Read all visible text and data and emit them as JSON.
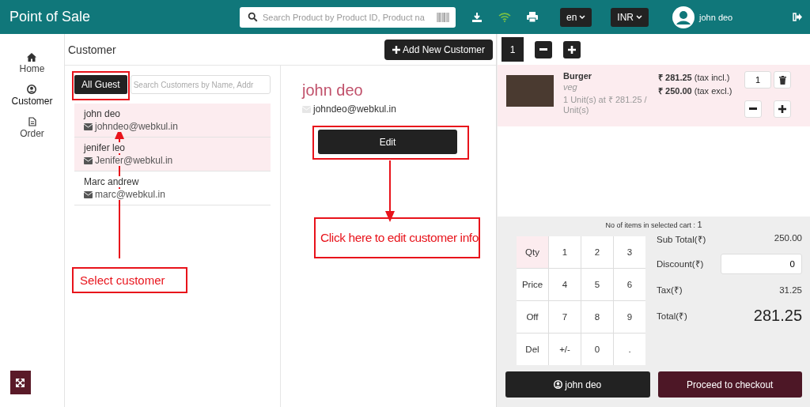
{
  "header": {
    "title": "Point of Sale",
    "search": {
      "placeholder": "Search Product by Product ID, Product na"
    },
    "language": "en",
    "currency": "INR",
    "user": "john deo"
  },
  "sidebar": {
    "items": [
      {
        "label": "Home",
        "selected": false
      },
      {
        "label": "Customer",
        "selected": true
      },
      {
        "label": "Order",
        "selected": false
      }
    ]
  },
  "customer_panel": {
    "title": "Customer",
    "add_button": "Add New Customer",
    "filter_button": "All Guest",
    "search": {
      "placeholder": "Search Customers by Name, Addr"
    },
    "customers": [
      {
        "name": "john deo",
        "email": "johndeo@webkul.in",
        "selected": true
      },
      {
        "name": "jenifer leo",
        "email": "Jenifer@webkul.in",
        "selected": true
      },
      {
        "name": "Marc andrew",
        "email": "marc@webkul.in",
        "selected": false
      }
    ],
    "detail": {
      "name": "john deo",
      "email": "johndeo@webkul.in",
      "edit_button": "Edit"
    }
  },
  "cart": {
    "tabs": [
      {
        "label": "1",
        "selected": true
      }
    ],
    "items": [
      {
        "name": "Burger",
        "variant": "veg",
        "unit_line": "1 Unit(s) at ₹ 281.25 / Unit(s)",
        "price_incl": "₹ 281.25",
        "incl_label": "(tax incl.)",
        "price_excl": "₹ 250.00",
        "excl_label": "(tax excl.)",
        "qty": "1"
      }
    ],
    "count_label": "No of items in selected cart :",
    "count": "1",
    "keypad": [
      {
        "label": "Qty",
        "selected": true
      },
      {
        "label": "1",
        "selected": false
      },
      {
        "label": "2",
        "selected": false
      },
      {
        "label": "3",
        "selected": false
      },
      {
        "label": "Price",
        "selected": false
      },
      {
        "label": "4",
        "selected": false
      },
      {
        "label": "5",
        "selected": false
      },
      {
        "label": "6",
        "selected": false
      },
      {
        "label": "Off",
        "selected": false
      },
      {
        "label": "7",
        "selected": false
      },
      {
        "label": "8",
        "selected": false
      },
      {
        "label": "9",
        "selected": false
      },
      {
        "label": "Del",
        "selected": false
      },
      {
        "label": "+/-",
        "selected": false
      },
      {
        "label": "0",
        "selected": false
      },
      {
        "label": ".",
        "selected": false
      }
    ],
    "sub_total": {
      "label": "Sub Total(₹)",
      "value": "250.00"
    },
    "discount": {
      "label": "Discount(₹)",
      "value": "0"
    },
    "tax": {
      "label": "Tax(₹)",
      "value": "31.25"
    },
    "total": {
      "label": "Total(₹)",
      "value": "281.25"
    },
    "customer_button": "john deo",
    "checkout_button": "Proceed to checkout"
  },
  "annotations": [
    {
      "kind": "arrow-up",
      "label": "Select customer"
    },
    {
      "kind": "arrow-down",
      "label": "Click here to edit customer info"
    }
  ]
}
